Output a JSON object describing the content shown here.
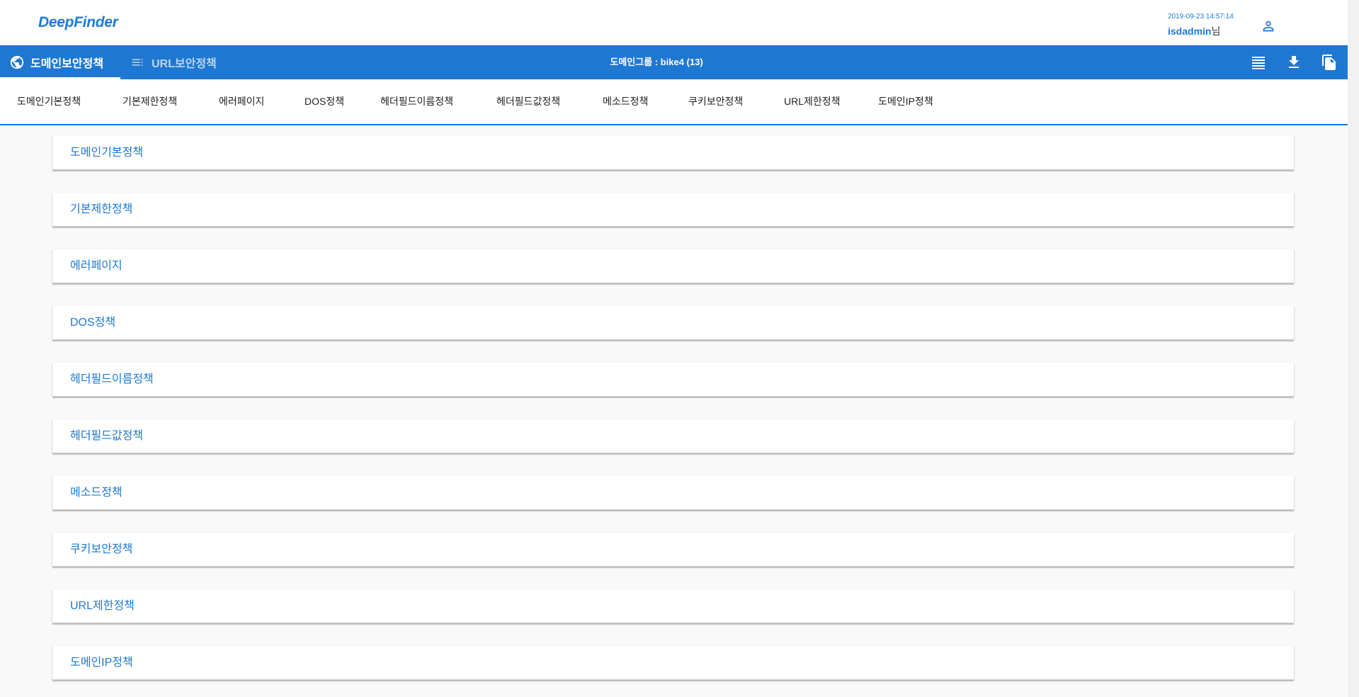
{
  "header": {
    "logo": "DeepFinder",
    "datetime": "2019-09-23 14:57:14",
    "username": "isdadmin",
    "honorific": "님"
  },
  "toolbar": {
    "tabs": [
      {
        "label": "도메인보안정책",
        "icon": "globe-icon"
      },
      {
        "label": "URL보안정책",
        "icon": "list-icon"
      }
    ],
    "group_label": "도메인그룹 : bike4 (13)",
    "actions": [
      "list-view-icon",
      "download-icon",
      "copy-icon"
    ]
  },
  "policy_tabs": [
    "도메인기본정책",
    "기본제한정책",
    "에러페이지",
    "DOS정책",
    "헤더필드이름정책",
    "헤더필드값정책",
    "메소드정책",
    "쿠키보안정책",
    "URL제한정책",
    "도메인IP정책"
  ],
  "sections": [
    "도메인기본정책",
    "기본제한정책",
    "에러페이지",
    "DOS정책",
    "헤더필드이름정책",
    "헤더필드값정책",
    "메소드정책",
    "쿠키보안정책",
    "URL제한정책",
    "도메인IP정책"
  ],
  "colors": {
    "accent": "#1e78d2",
    "header_bg": "#ffffff",
    "page_bg": "#f9f9f9"
  }
}
